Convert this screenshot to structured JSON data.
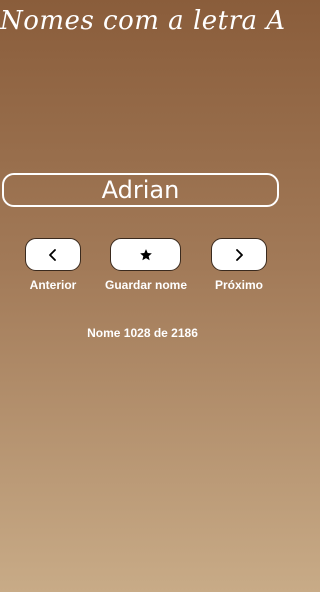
{
  "header": {
    "title": "Nomes com a letra A"
  },
  "current_name": "Adrian",
  "controls": {
    "previous_label": "Anterior",
    "favorite_label": "Guardar nome",
    "next_label": "Próximo",
    "previous_icon": "chevron-left-icon",
    "favorite_icon": "star-icon",
    "next_icon": "chevron-right-icon"
  },
  "counter": {
    "text": "Nome 1028 de 2186"
  },
  "colors": {
    "background_top": "#8a5d3b",
    "background_bottom": "#c8ab87",
    "text": "#ffffff",
    "button_fill": "#ffffff",
    "icon": "#000000"
  }
}
